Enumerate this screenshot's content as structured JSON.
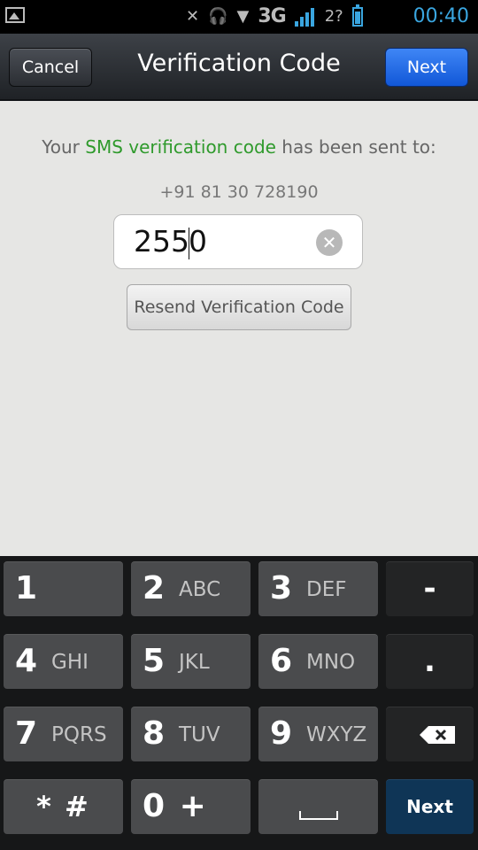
{
  "status_bar": {
    "network": "3G",
    "sim_label": "2?",
    "time": "00:40"
  },
  "action_bar": {
    "title": "Verification Code",
    "cancel_label": "Cancel",
    "next_label": "Next"
  },
  "content": {
    "message_prefix": "Your ",
    "message_highlight": "SMS verification code",
    "message_suffix": " has been sent to:",
    "phone_number": "+91 81 30 728190",
    "code_before_caret": "255",
    "code_after_caret": "0",
    "resend_label": "Resend Verification Code",
    "colors": {
      "highlight": "#2f9a2c",
      "primary_button": "#1157d8"
    }
  },
  "keypad": {
    "keys": [
      {
        "num": "1",
        "letters": ""
      },
      {
        "num": "2",
        "letters": "ABC"
      },
      {
        "num": "3",
        "letters": "DEF"
      },
      {
        "num": "-",
        "letters": ""
      },
      {
        "num": "4",
        "letters": "GHI"
      },
      {
        "num": "5",
        "letters": "JKL"
      },
      {
        "num": "6",
        "letters": "MNO"
      },
      {
        "num": ".",
        "letters": ""
      },
      {
        "num": "7",
        "letters": "PQRS"
      },
      {
        "num": "8",
        "letters": "TUV"
      },
      {
        "num": "9",
        "letters": "WXYZ"
      },
      {
        "num": "",
        "letters": ""
      },
      {
        "num": "* #",
        "letters": ""
      },
      {
        "num": "0 +",
        "letters": ""
      },
      {
        "num": "",
        "letters": ""
      },
      {
        "num": "Next",
        "letters": ""
      }
    ]
  }
}
